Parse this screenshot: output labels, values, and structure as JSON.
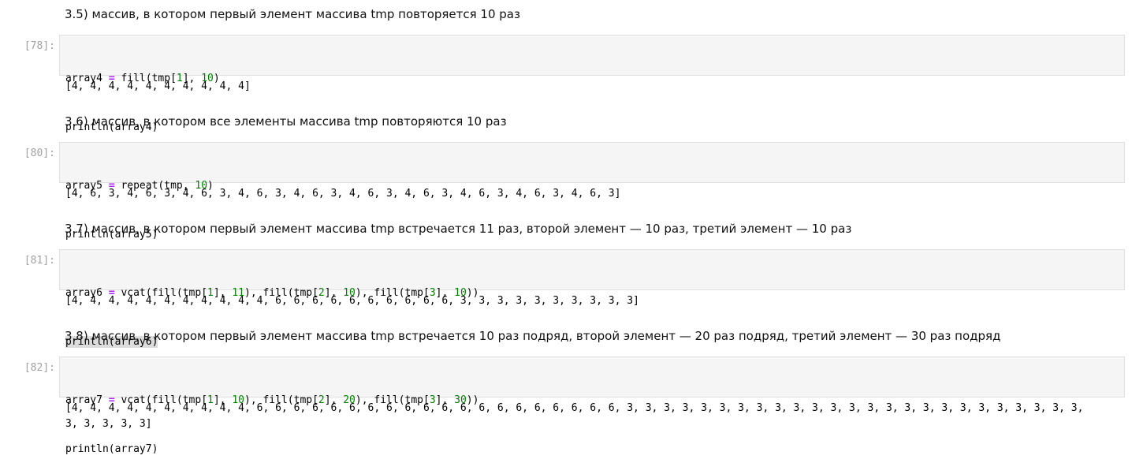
{
  "sections": [
    {
      "heading": "3.5) массив, в котором первый элемент массива tmp повторяется 10 раз",
      "prompt": "[78]:",
      "code": {
        "l1": {
          "a": "array4 ",
          "op": "=",
          "b": " fill(tmp[",
          "n1": "1",
          "c": "], ",
          "n2": "10",
          "d": ")"
        },
        "l2": "println(array4)"
      },
      "output": "[4, 4, 4, 4, 4, 4, 4, 4, 4, 4]"
    },
    {
      "heading": "3.6) массив, в котором все элементы массива tmp повторяются 10 раз",
      "prompt": "[80]:",
      "code": {
        "l1": {
          "a": "array5 ",
          "op": "=",
          "b": " repeat(tmp, ",
          "n1": "10",
          "c": ")"
        },
        "l2": "println(array5)"
      },
      "output": "[4, 6, 3, 4, 6, 3, 4, 6, 3, 4, 6, 3, 4, 6, 3, 4, 6, 3, 4, 6, 3, 4, 6, 3, 4, 6, 3, 4, 6, 3]"
    },
    {
      "heading": "3.7) массив, в котором первый элемент массива tmp встречается 11 раз, второй элемент — 10 раз, третий элемент — 10 раз",
      "prompt": "[81]:",
      "code": {
        "l1": {
          "a": "array6 ",
          "op": "=",
          "b": " vcat(fill(tmp[",
          "n1": "1",
          "c": "], ",
          "n2": "11",
          "d": "), fill(tmp[",
          "n3": "2",
          "e": "], ",
          "n4": "10",
          "f": "), fill(tmp[",
          "n5": "3",
          "g": "], ",
          "n6": "10",
          "h": "))"
        },
        "l2": "println(array6)"
      },
      "output": "[4, 4, 4, 4, 4, 4, 4, 4, 4, 4, 4, 6, 6, 6, 6, 6, 6, 6, 6, 6, 6, 3, 3, 3, 3, 3, 3, 3, 3, 3, 3]"
    },
    {
      "heading": "3.8) массив, в котором первый элемент массива tmp встречается 10 раз подряд, второй элемент — 20 раз подряд, третий элемент — 30 раз подряд",
      "prompt": "[82]:",
      "code": {
        "l1": {
          "a": "array7 ",
          "op": "=",
          "b": " vcat(fill(tmp[",
          "n1": "1",
          "c": "], ",
          "n2": "10",
          "d": "), fill(tmp[",
          "n3": "2",
          "e": "], ",
          "n4": "20",
          "f": "), fill(tmp[",
          "n5": "3",
          "g": "], ",
          "n6": "30",
          "h": "))"
        },
        "l2": "println(array7)"
      },
      "output_line1": "[4, 4, 4, 4, 4, 4, 4, 4, 4, 4, 6, 6, 6, 6, 6, 6, 6, 6, 6, 6, 6, 6, 6, 6, 6, 6, 6, 6, 6, 6, 3, 3, 3, 3, 3, 3, 3, 3, 3, 3, 3, 3, 3, 3, 3, 3, 3, 3, 3, 3, 3, 3, 3, 3, 3,",
      "output_line2": "3, 3, 3, 3, 3]"
    }
  ]
}
